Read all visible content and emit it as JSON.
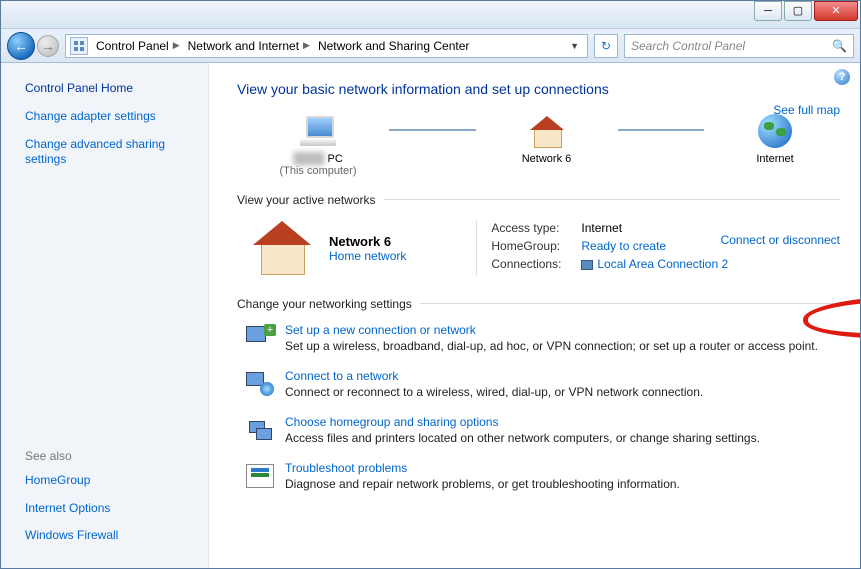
{
  "window": {
    "breadcrumbs": [
      "Control Panel",
      "Network and Internet",
      "Network and Sharing Center"
    ],
    "search_placeholder": "Search Control Panel"
  },
  "sidebar": {
    "home": "Control Panel Home",
    "links": [
      "Change adapter settings",
      "Change advanced sharing settings"
    ],
    "seealso_hdr": "See also",
    "seealso": [
      "HomeGroup",
      "Internet Options",
      "Windows Firewall"
    ]
  },
  "main": {
    "title": "View your basic network information and set up connections",
    "fullmap": "See full map",
    "connect": "Connect or disconnect",
    "map": {
      "pc_name": "PC",
      "pc_sub": "(This computer)",
      "net_name": "Network  6",
      "inet_name": "Internet"
    },
    "active_hdr": "View your active networks",
    "active": {
      "name": "Network  6",
      "type": "Home network",
      "rows": {
        "access_lbl": "Access type:",
        "access_val": "Internet",
        "hg_lbl": "HomeGroup:",
        "hg_val": "Ready to create",
        "conn_lbl": "Connections:",
        "conn_val": "Local Area Connection 2"
      }
    },
    "settings_hdr": "Change your networking settings",
    "tasks": [
      {
        "title": "Set up a new connection or network",
        "desc": "Set up a wireless, broadband, dial-up, ad hoc, or VPN connection; or set up a router or access point."
      },
      {
        "title": "Connect to a network",
        "desc": "Connect or reconnect to a wireless, wired, dial-up, or VPN network connection."
      },
      {
        "title": "Choose homegroup and sharing options",
        "desc": "Access files and printers located on other network computers, or change sharing settings."
      },
      {
        "title": "Troubleshoot problems",
        "desc": "Diagnose and repair network problems, or get troubleshooting information."
      }
    ]
  }
}
